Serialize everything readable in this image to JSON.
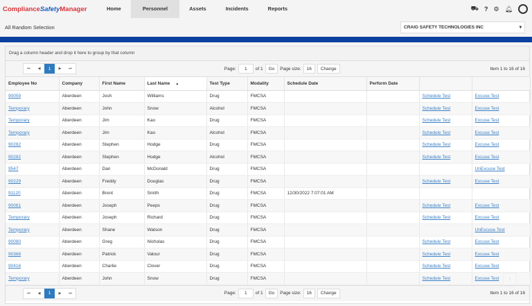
{
  "app": {
    "logo_part1": "Compliance",
    "logo_part2": "Safety",
    "logo_part3": "Manager"
  },
  "nav": [
    {
      "label": "Home"
    },
    {
      "label": "Personnel",
      "active": true
    },
    {
      "label": "Assets"
    },
    {
      "label": "Incidents"
    },
    {
      "label": "Reports"
    }
  ],
  "header_icons": [
    "truck-icon",
    "help-icon",
    "gear-icon",
    "bell-icon",
    "user-avatar-icon"
  ],
  "page_title": "All Random Selection",
  "company_select": {
    "value": "CRAIG SAFETY TECHNOLOGIES INC"
  },
  "grid": {
    "group_hint": "Drag a column header and drop it here to group by that column",
    "pager": {
      "current_page": "1",
      "page_label": "Page:",
      "page_value": "1",
      "of_label": "of 1",
      "go": "Go",
      "page_size_label": "Page size:",
      "page_size": "16",
      "change": "Change",
      "info": "Item 1 to 16 of 16"
    },
    "columns": [
      "Employee No",
      "Company",
      "First Name",
      "Last Name",
      "Test Type",
      "Modality",
      "Schedule Date",
      "Perform Date",
      "",
      ""
    ],
    "sort_indicator": "▲",
    "rows": [
      [
        "90059",
        "Aberdeen",
        "Josh",
        "Williams",
        "Drug",
        "FMCSA",
        "",
        "",
        "Schedule Test",
        "Excuse Test"
      ],
      [
        "Temporary",
        "Aberdeen",
        "John",
        "Snow",
        "Alcohol",
        "FMCSA",
        "",
        "",
        "Schedule Test",
        "Excuse Test"
      ],
      [
        "Temporary",
        "Aberdeen",
        "Jim",
        "Kao",
        "Drug",
        "FMCSA",
        "",
        "",
        "Schedule Test",
        "Excuse Test"
      ],
      [
        "Temporary",
        "Aberdeen",
        "Jim",
        "Kao",
        "Alcohol",
        "FMCSA",
        "",
        "",
        "Schedule Test",
        "Excuse Test"
      ],
      [
        "90282",
        "Aberdeen",
        "Stephen",
        "Hodge",
        "Drug",
        "FMCSA",
        "",
        "",
        "Schedule Test",
        "Excuse Test"
      ],
      [
        "90282",
        "Aberdeen",
        "Stephen",
        "Hodge",
        "Alcohol",
        "FMCSA",
        "",
        "",
        "Schedule Test",
        "Excuse Test"
      ],
      [
        "9547",
        "Aberdeen",
        "Dan",
        "McDonald",
        "Drug",
        "FMCSA",
        "",
        "",
        "",
        "UnExcuse Test"
      ],
      [
        "90229",
        "Aberdeen",
        "Freddy",
        "Douglas",
        "Drug",
        "FMCSA",
        "",
        "",
        "Schedule Test",
        "Excuse Test"
      ],
      [
        "91120",
        "Aberdeen",
        "Brent",
        "Smith",
        "Drug",
        "FMCSA",
        "12/30/2022 7:07:01 AM",
        "",
        "",
        ""
      ],
      [
        "90061",
        "Aberdeen",
        "Joseph",
        "Peeps",
        "Drug",
        "FMCSA",
        "",
        "",
        "Schedule Test",
        "Excuse Test"
      ],
      [
        "Temporary",
        "Aberdeen",
        "Joseph",
        "Richard",
        "Drug",
        "FMCSA",
        "",
        "",
        "Schedule Test",
        "Excuse Test"
      ],
      [
        "Temporary",
        "Aberdeen",
        "Shane",
        "Watson",
        "Drug",
        "FMCSA",
        "",
        "",
        "",
        "UnExcuse Test"
      ],
      [
        "90080",
        "Aberdeen",
        "Greg",
        "Nicholas",
        "Drug",
        "FMCSA",
        "",
        "",
        "Schedule Test",
        "Excuse Test"
      ],
      [
        "90368",
        "Aberdeen",
        "Patrick",
        "Valour",
        "Drug",
        "FMCSA",
        "",
        "",
        "Schedule Test",
        "Excuse Test"
      ],
      [
        "90416",
        "Aberdeen",
        "Charlie",
        "Clover",
        "Drug",
        "FMCSA",
        "",
        "",
        "Schedule Test",
        "Excuse Test"
      ],
      [
        "Temporary",
        "Aberdeen",
        "John",
        "Snow",
        "Drug",
        "FMCSA",
        "",
        "",
        "Schedule Test",
        "Excuse Test"
      ]
    ]
  },
  "colors": {
    "accent": "#2f7bbf",
    "band": "#0b3fa0",
    "logo_red": "#d9343a",
    "link": "#3a7fc4"
  }
}
